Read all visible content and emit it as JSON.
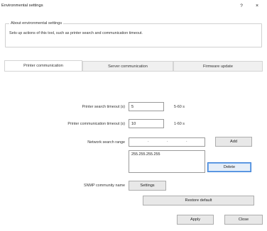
{
  "window": {
    "title": "Environmental settings",
    "help": "?",
    "close": "×"
  },
  "about": {
    "legend": "About environmental settings",
    "description": "Sets up actions of this tool, such as printer search and communication timeout."
  },
  "tabs": [
    {
      "label": "Printer communication",
      "active": true
    },
    {
      "label": "Server communication",
      "active": false
    },
    {
      "label": "Firmware update",
      "active": false
    }
  ],
  "printer_comm": {
    "search_timeout_label": "Printer search timeout (s)",
    "search_timeout_value": "5",
    "search_timeout_hint": "5-60 s",
    "comm_timeout_label": "Printer communication timeout (s)",
    "comm_timeout_value": "10",
    "comm_timeout_hint": "1-60 s",
    "network_range_label": "Network search range",
    "add_label": "Add",
    "ranges": [
      "255.255.255.255"
    ],
    "delete_label": "Delete",
    "snmp_label": "SNMP community name",
    "settings_label": "Settings",
    "restore_label": "Restore default"
  },
  "footer": {
    "apply_label": "Apply",
    "close_label": "Close"
  },
  "colors": {
    "focus_border": "#3c7fd6",
    "button_bg": "#e8e8e8"
  }
}
